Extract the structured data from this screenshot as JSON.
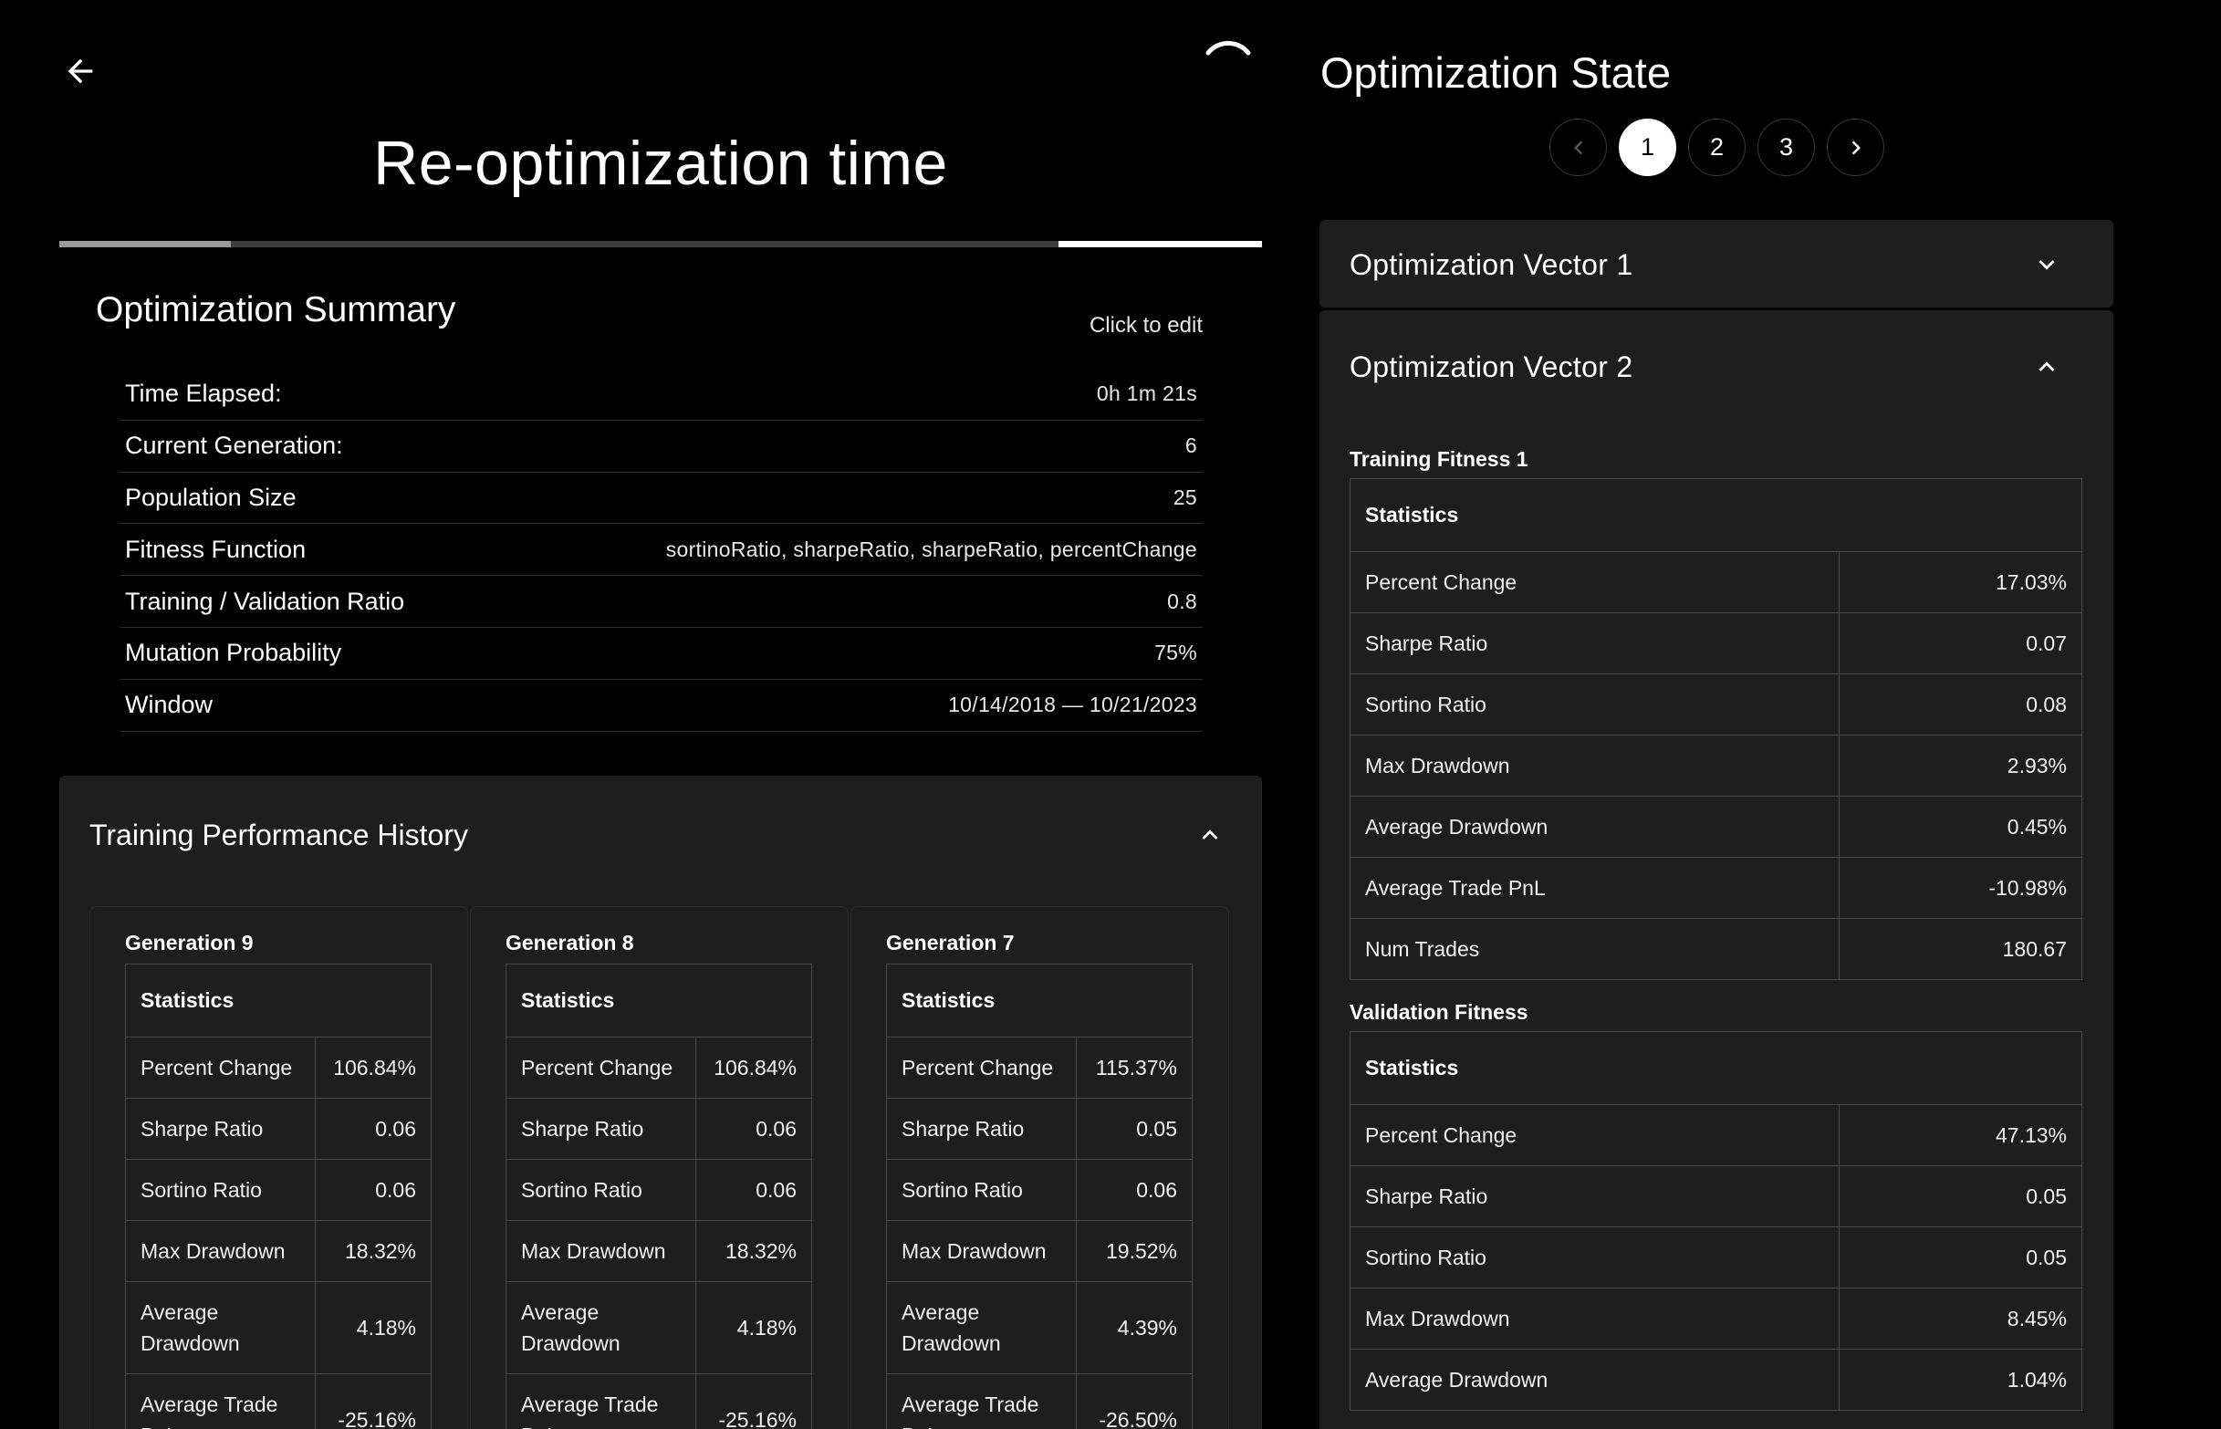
{
  "header": {
    "title": "Re-optimization time",
    "back_icon": "arrow-left-icon",
    "progress_segments": [
      {
        "label": "complete",
        "fraction_start": 0.0,
        "fraction_end": 0.143,
        "color": "#9a9a9a"
      },
      {
        "label": "remaining",
        "fraction_start": 0.143,
        "fraction_end": 0.831,
        "color": "#3d3d3d"
      },
      {
        "label": "current",
        "fraction_start": 0.831,
        "fraction_end": 1.0,
        "color": "#ffffff"
      }
    ]
  },
  "summary": {
    "title": "Optimization Summary",
    "edit_label": "Click to edit",
    "rows": [
      {
        "key": "Time Elapsed:",
        "value": "0h 1m 21s"
      },
      {
        "key": "Current Generation:",
        "value": "6"
      },
      {
        "key": "Population Size",
        "value": "25"
      },
      {
        "key": "Fitness Function",
        "value": "sortinoRatio, sharpeRatio, sharpeRatio, percentChange"
      },
      {
        "key": "Training / Validation Ratio",
        "value": "0.8"
      },
      {
        "key": "Mutation Probability",
        "value": "75%"
      },
      {
        "key": "Window",
        "value": "10/14/2018 — 10/21/2023"
      }
    ]
  },
  "history": {
    "title": "Training Performance History",
    "stats_header": "Statistics",
    "generations": [
      {
        "title": "Generation 9",
        "rows": [
          {
            "name": "Percent Change",
            "value": "106.84%"
          },
          {
            "name": "Sharpe Ratio",
            "value": "0.06"
          },
          {
            "name": "Sortino Ratio",
            "value": "0.06"
          },
          {
            "name": "Max Drawdown",
            "value": "18.32%"
          },
          {
            "name": "Average Drawdown",
            "value": "4.18%"
          },
          {
            "name": "Average Trade PnL",
            "value": "-25.16%"
          }
        ]
      },
      {
        "title": "Generation 8",
        "rows": [
          {
            "name": "Percent Change",
            "value": "106.84%"
          },
          {
            "name": "Sharpe Ratio",
            "value": "0.06"
          },
          {
            "name": "Sortino Ratio",
            "value": "0.06"
          },
          {
            "name": "Max Drawdown",
            "value": "18.32%"
          },
          {
            "name": "Average Drawdown",
            "value": "4.18%"
          },
          {
            "name": "Average Trade PnL",
            "value": "-25.16%"
          }
        ]
      },
      {
        "title": "Generation 7",
        "rows": [
          {
            "name": "Percent Change",
            "value": "115.37%"
          },
          {
            "name": "Sharpe Ratio",
            "value": "0.05"
          },
          {
            "name": "Sortino Ratio",
            "value": "0.06"
          },
          {
            "name": "Max Drawdown",
            "value": "19.52%"
          },
          {
            "name": "Average Drawdown",
            "value": "4.39%"
          },
          {
            "name": "Average Trade PnL",
            "value": "-26.50%"
          }
        ]
      }
    ]
  },
  "state": {
    "title": "Optimization State",
    "pages": [
      "1",
      "2",
      "3"
    ],
    "active_page": "1",
    "vector1": {
      "title": "Optimization Vector 1"
    },
    "vector2": {
      "title": "Optimization Vector 2",
      "stats_header": "Statistics",
      "training": {
        "title": "Training Fitness 1",
        "rows": [
          {
            "name": "Percent Change",
            "value": "17.03%"
          },
          {
            "name": "Sharpe Ratio",
            "value": "0.07"
          },
          {
            "name": "Sortino Ratio",
            "value": "0.08"
          },
          {
            "name": "Max Drawdown",
            "value": "2.93%"
          },
          {
            "name": "Average Drawdown",
            "value": "0.45%"
          },
          {
            "name": "Average Trade PnL",
            "value": "-10.98%"
          },
          {
            "name": "Num Trades",
            "value": "180.67"
          }
        ]
      },
      "validation": {
        "title": "Validation Fitness",
        "rows": [
          {
            "name": "Percent Change",
            "value": "47.13%"
          },
          {
            "name": "Sharpe Ratio",
            "value": "0.05"
          },
          {
            "name": "Sortino Ratio",
            "value": "0.05"
          },
          {
            "name": "Max Drawdown",
            "value": "8.45%"
          },
          {
            "name": "Average Drawdown",
            "value": "1.04%"
          }
        ]
      }
    }
  }
}
